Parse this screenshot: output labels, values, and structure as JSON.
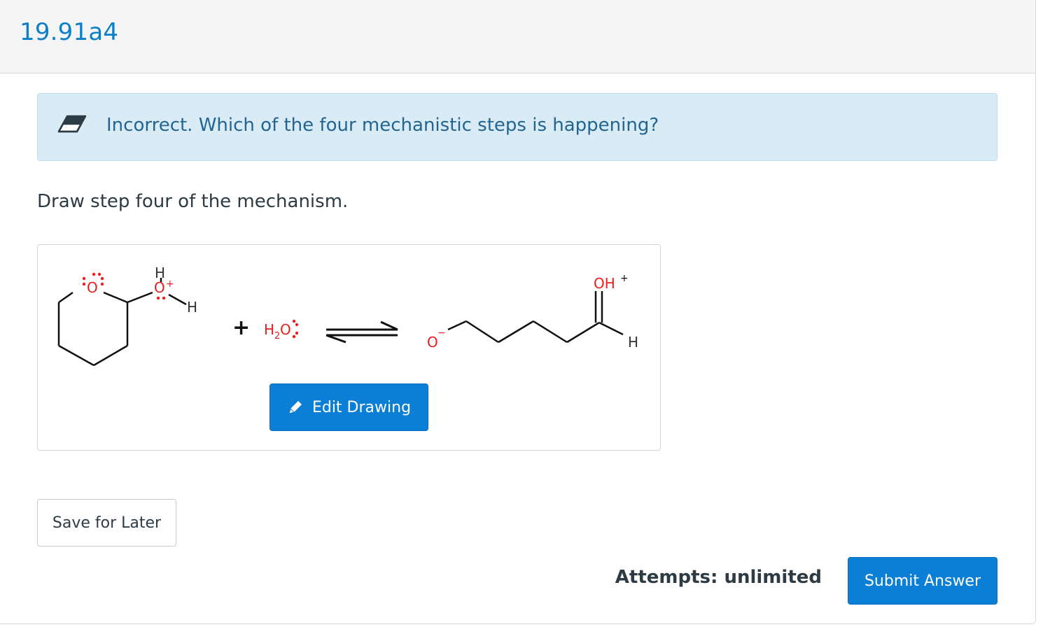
{
  "header": {
    "question_title": "19.91a4"
  },
  "feedback": {
    "icon": "eraser-icon",
    "message": "Incorrect. Which of the four mechanistic steps is happening?",
    "color": "#236592",
    "background": "#d9ecf5"
  },
  "question": {
    "prompt": "Draw step four of the mechanism."
  },
  "drawing": {
    "reactant_1": {
      "ring_oxygen": "O",
      "oxonium_h_top": "H",
      "oxonium_o": "O",
      "oxonium_charge": "+",
      "oxonium_h_side": "H"
    },
    "plus_sign": "+",
    "reactant_2": {
      "h": "H",
      "sub": "2",
      "o": "O"
    },
    "arrow": "equilibrium-arrow",
    "product": {
      "alkoxide_o": "O",
      "alkoxide_charge": "−",
      "oh": "OH",
      "oh_charge": "+",
      "aldehyde_h": "H"
    },
    "atom_colors": {
      "oxygen": "#e8201f",
      "bond": "#111111",
      "hydrogen": "#333333",
      "lone_pair": "#e8201f"
    },
    "edit_button_label": "Edit Drawing",
    "edit_icon": "pencil-icon"
  },
  "footer": {
    "save_label": "Save for Later",
    "attempts_label": "Attempts: unlimited",
    "submit_label": "Submit Answer"
  },
  "colors": {
    "accent": "#0b7fd6",
    "title": "#0b7fc7",
    "text": "#2d3b45"
  }
}
